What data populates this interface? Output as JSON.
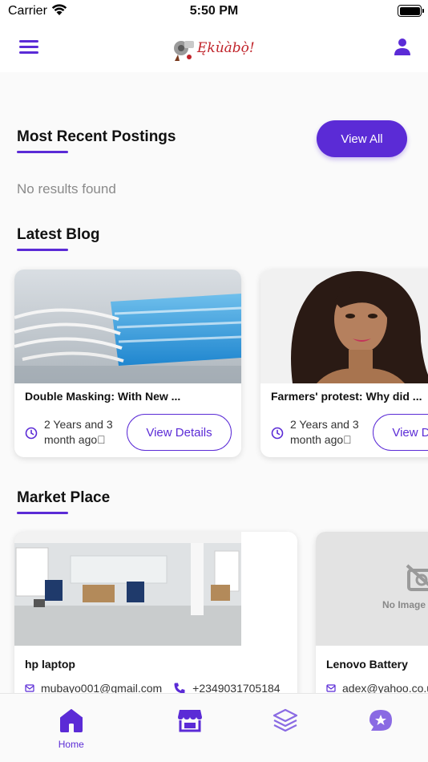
{
  "status_bar": {
    "carrier": "Carrier",
    "time": "5:50 PM"
  },
  "app": {
    "logo_text": "Ękùàbọ̀!"
  },
  "recent": {
    "title": "Most Recent Postings",
    "view_all": "View All",
    "empty": "No results found"
  },
  "blog": {
    "title": "Latest Blog",
    "posts": [
      {
        "title": "Double Masking: With New ...",
        "age": "2 Years and 3 month ago\u0000",
        "button": "View Details"
      },
      {
        "title": "Farmers' protest: Why did ...",
        "age": "2 Years and 3 month ago\u0000",
        "button": "View Details"
      }
    ]
  },
  "market": {
    "title": "Market Place",
    "items": [
      {
        "title": "hp laptop",
        "email": "mubayo001@gmail.com",
        "phone": "+2349031705184"
      },
      {
        "title": "Lenovo Battery",
        "email": "adex@yahoo.co.uk",
        "no_image": "No Image"
      }
    ]
  },
  "tabbar": {
    "home_label": "Home"
  },
  "colors": {
    "accent": "#5b2bd6",
    "logo": "#c0232a"
  }
}
